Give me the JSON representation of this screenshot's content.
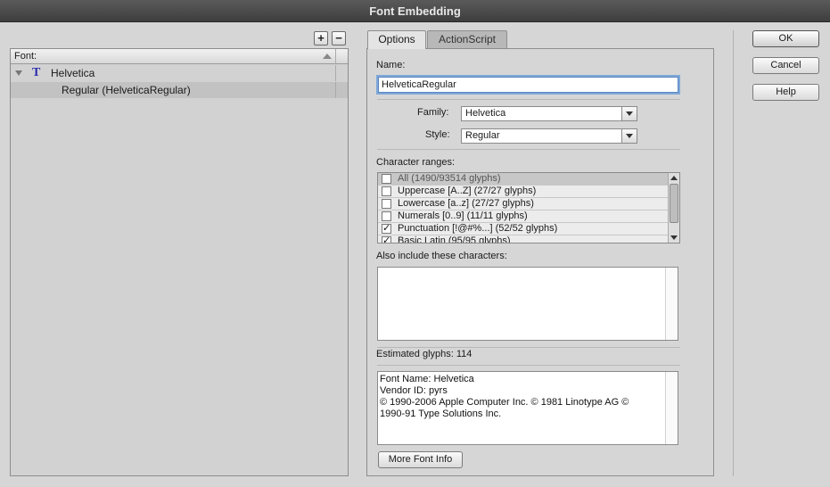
{
  "window": {
    "title": "Font Embedding"
  },
  "font_panel": {
    "add_label": "+",
    "remove_label": "−",
    "column_header": "Font:",
    "family_icon_glyph": "T",
    "family_name": "Helvetica",
    "style_item": "Regular (HelveticaRegular)"
  },
  "tabs": [
    {
      "label": "Options",
      "active": true
    },
    {
      "label": "ActionScript",
      "active": false
    }
  ],
  "options": {
    "name_label": "Name:",
    "name_value": "HelveticaRegular",
    "family_label": "Family:",
    "family_value": "Helvetica",
    "style_label": "Style:",
    "style_value": "Regular",
    "ranges_label": "Character ranges:",
    "ranges": [
      {
        "label": "All  (1490/93514 glyphs)",
        "checked": false
      },
      {
        "label": "Uppercase [A..Z]  (27/27 glyphs)",
        "checked": false
      },
      {
        "label": "Lowercase [a..z]  (27/27 glyphs)",
        "checked": false
      },
      {
        "label": "Numerals [0..9]  (11/11 glyphs)",
        "checked": false
      },
      {
        "label": "Punctuation [!@#%...]  (52/52 glyphs)",
        "checked": true
      },
      {
        "label": "Basic Latin  (95/95 glyphs)",
        "checked": true
      }
    ],
    "include_label": "Also include these characters:",
    "include_value": "",
    "estimated_label": "Estimated glyphs: 114",
    "font_info": "Font Name: Helvetica\nVendor ID: pyrs\n© 1990-2006 Apple Computer Inc. © 1981 Linotype AG ©\n1990-91 Type Solutions Inc.",
    "more_info_button": "More Font Info"
  },
  "buttons": {
    "ok": "OK",
    "cancel": "Cancel",
    "help": "Help"
  },
  "check_glyph": "✓"
}
